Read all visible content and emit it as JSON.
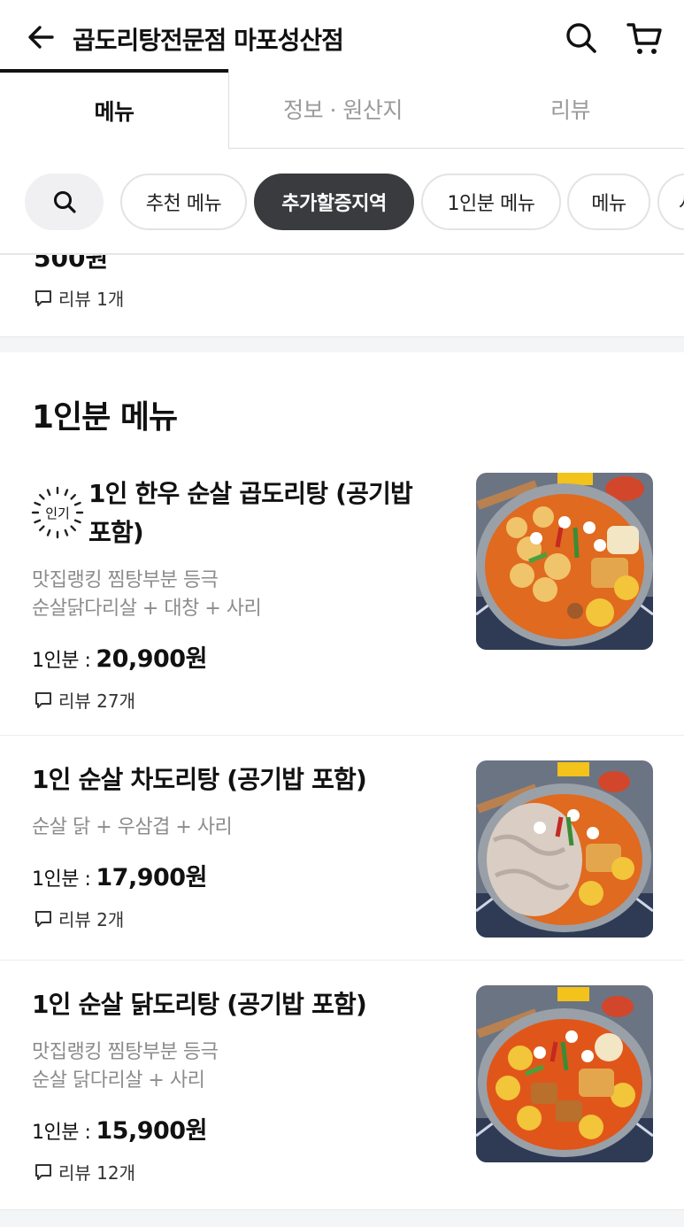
{
  "header": {
    "title": "곱도리탕전문점 마포성산점",
    "back_icon": "arrow-left-icon",
    "search_icon": "search-icon",
    "cart_icon": "cart-icon"
  },
  "tabs": [
    {
      "label": "메뉴",
      "active": true
    },
    {
      "label": "정보 · 원산지",
      "active": false
    },
    {
      "label": "리뷰",
      "active": false
    }
  ],
  "chips": [
    {
      "label": "추천 메뉴",
      "active": false
    },
    {
      "label": "추가할증지역",
      "active": true
    },
    {
      "label": "1인분 메뉴",
      "active": false
    },
    {
      "label": "메뉴",
      "active": false
    },
    {
      "label": "사",
      "active": false
    }
  ],
  "prev_item": {
    "price_fragment": "500원",
    "review": "리뷰 1개"
  },
  "section": {
    "title": "1인분 메뉴"
  },
  "items": [
    {
      "badge": "인기",
      "name_line1": "1인 한우 순살 곱도리탕 (공기밥",
      "name_line2": "포함)",
      "desc_line1": "맛집랭킹 찜탕부분 등극",
      "desc_line2": "순살닭다리살  + 대창 + 사리",
      "price_label": "1인분 :",
      "price_value": "20,900원",
      "review": "리뷰 27개"
    },
    {
      "name_line1": "1인 순살 차도리탕 (공기밥 포함)",
      "desc_line1": "순살 닭 + 우삼겹  + 사리",
      "price_label": "1인분 :",
      "price_value": "17,900원",
      "review": "리뷰 2개"
    },
    {
      "name_line1": "1인 순살 닭도리탕 (공기밥 포함)",
      "desc_line1": "맛집랭킹 찜탕부분 등극",
      "desc_line2": "순살 닭다리살  + 사리",
      "price_label": "1인분 :",
      "price_value": "15,900원",
      "review": "리뷰 12개"
    }
  ],
  "colors": {
    "accent_dark": "#3a3b3e",
    "muted_text": "#8c8c8c",
    "divider": "#ececec"
  }
}
